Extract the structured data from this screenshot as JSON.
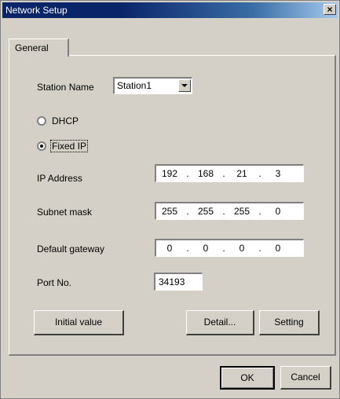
{
  "window": {
    "title": "Network Setup"
  },
  "tabs": [
    {
      "label": "General",
      "active": true
    }
  ],
  "form": {
    "station_name": {
      "label": "Station Name",
      "value": "Station1"
    },
    "dhcp": {
      "label": "DHCP",
      "selected": false
    },
    "fixed_ip": {
      "label": "Fixed IP",
      "selected": true
    },
    "ip_address": {
      "label": "IP Address",
      "octets": [
        "192",
        "168",
        "21",
        "3"
      ]
    },
    "subnet_mask": {
      "label": "Subnet mask",
      "octets": [
        "255",
        "255",
        "255",
        "0"
      ]
    },
    "default_gateway": {
      "label": "Default gateway",
      "octets": [
        "0",
        "0",
        "0",
        "0"
      ]
    },
    "port": {
      "label": "Port No.",
      "value": "34193"
    }
  },
  "buttons": {
    "initial_value": "Initial value",
    "detail": "Detail...",
    "setting": "Setting",
    "ok": "OK",
    "cancel": "Cancel"
  },
  "icons": {
    "close": "close-icon"
  }
}
